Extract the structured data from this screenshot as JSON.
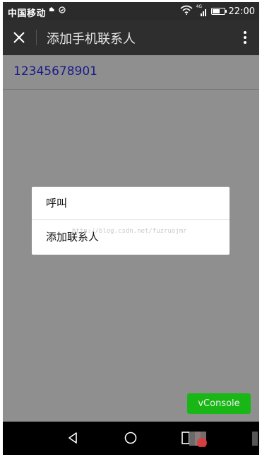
{
  "status_bar": {
    "carrier": "中国移动",
    "signal_label": "4G",
    "time": "22:00",
    "battery_level": 0.6
  },
  "title_bar": {
    "title": "添加手机联系人"
  },
  "content": {
    "phone_number": "12345678901"
  },
  "dialog": {
    "items": [
      {
        "label": "呼叫"
      },
      {
        "label": "添加联系人"
      }
    ]
  },
  "watermark": "http://blog.csdn.net/fuzruojmr",
  "vconsole": {
    "label": "vConsole",
    "color": "#04be02"
  },
  "icons": {
    "close": "close-icon",
    "more": "more-vertical-icon",
    "wifi": "wifi-icon",
    "signal": "signal-icon",
    "battery": "battery-icon",
    "back": "back-triangle-icon",
    "home": "home-circle-icon",
    "recent": "recent-apps-icon"
  }
}
